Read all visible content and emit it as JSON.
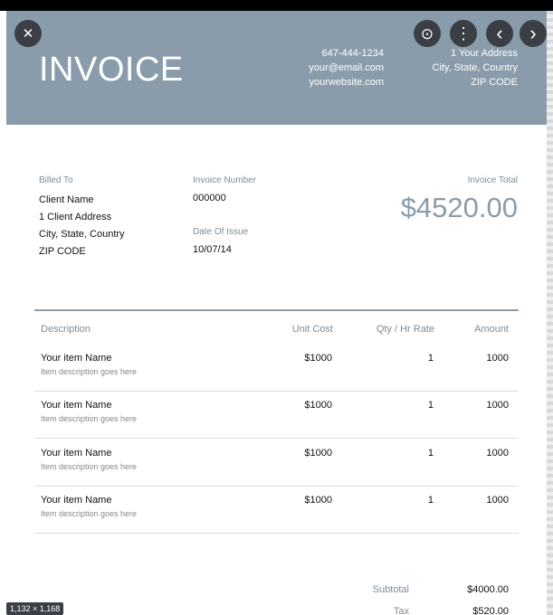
{
  "header": {
    "title": "INVOICE",
    "contact": {
      "phone": "647-444-1234",
      "email": "your@email.com",
      "website": "yourwebsite.com"
    },
    "address": {
      "line1": "1 Your Address",
      "line2": "City, State, Country",
      "line3": "ZIP CODE"
    }
  },
  "overlay": {
    "close_glyph": "✕",
    "lens_glyph": "⊙",
    "more_glyph": "⋮",
    "prev_glyph": "‹",
    "next_glyph": "›",
    "size_badge": "1,132 × 1,168"
  },
  "billing": {
    "billed_to_label": "Billed To",
    "client_name": "Client Name",
    "client_address": "1 Client Address",
    "client_city": "City, State, Country",
    "client_zip": "ZIP CODE",
    "invoice_number_label": "Invoice Number",
    "invoice_number": "000000",
    "date_label": "Date Of Issue",
    "date": "10/07/14",
    "total_label": "Invoice Total",
    "total": "$4520.00"
  },
  "table": {
    "headers": {
      "description": "Description",
      "unit_cost": "Unit Cost",
      "qty": "Qty / Hr Rate",
      "amount": "Amount"
    },
    "rows": [
      {
        "name": "Your item Name",
        "desc": "Item description goes here",
        "unit_cost": "$1000",
        "qty": "1",
        "amount": "1000"
      },
      {
        "name": "Your item Name",
        "desc": "Item description goes here",
        "unit_cost": "$1000",
        "qty": "1",
        "amount": "1000"
      },
      {
        "name": "Your item Name",
        "desc": "Item description goes here",
        "unit_cost": "$1000",
        "qty": "1",
        "amount": "1000"
      },
      {
        "name": "Your item Name",
        "desc": "Item description goes here",
        "unit_cost": "$1000",
        "qty": "1",
        "amount": "1000"
      }
    ]
  },
  "summary": {
    "subtotal_label": "Subtotal",
    "subtotal": "$4000.00",
    "tax_label": "Tax",
    "tax": "$520.00"
  },
  "colors": {
    "header_bg": "#8a9cab",
    "accent_text": "#8a9cab",
    "overlay_button": "#3b3f45"
  }
}
